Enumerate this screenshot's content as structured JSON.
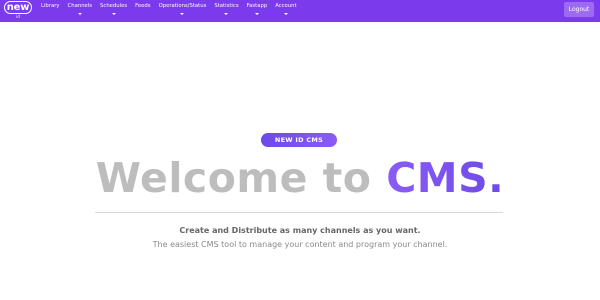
{
  "brand": {
    "logo_text": "new",
    "logo_sub": "id",
    "accent_color": "#7c3aed"
  },
  "nav": {
    "items": [
      {
        "label": "Library",
        "has_dropdown": false
      },
      {
        "label": "Channels",
        "has_dropdown": true
      },
      {
        "label": "Schedules",
        "has_dropdown": true
      },
      {
        "label": "Feeds",
        "has_dropdown": false
      },
      {
        "label": "Operations/Status",
        "has_dropdown": true
      },
      {
        "label": "Statistics",
        "has_dropdown": true
      },
      {
        "label": "Fastapp",
        "has_dropdown": true
      },
      {
        "label": "Account",
        "has_dropdown": true
      }
    ],
    "logout_label": "Logout"
  },
  "hero": {
    "badge": "NEW ID CMS",
    "title_part1": "Welcome to ",
    "title_part2": "CMS.",
    "tagline": "Create and Distribute as many channels as you want.",
    "subline": "The easiest CMS tool to manage your content and program your channel."
  }
}
